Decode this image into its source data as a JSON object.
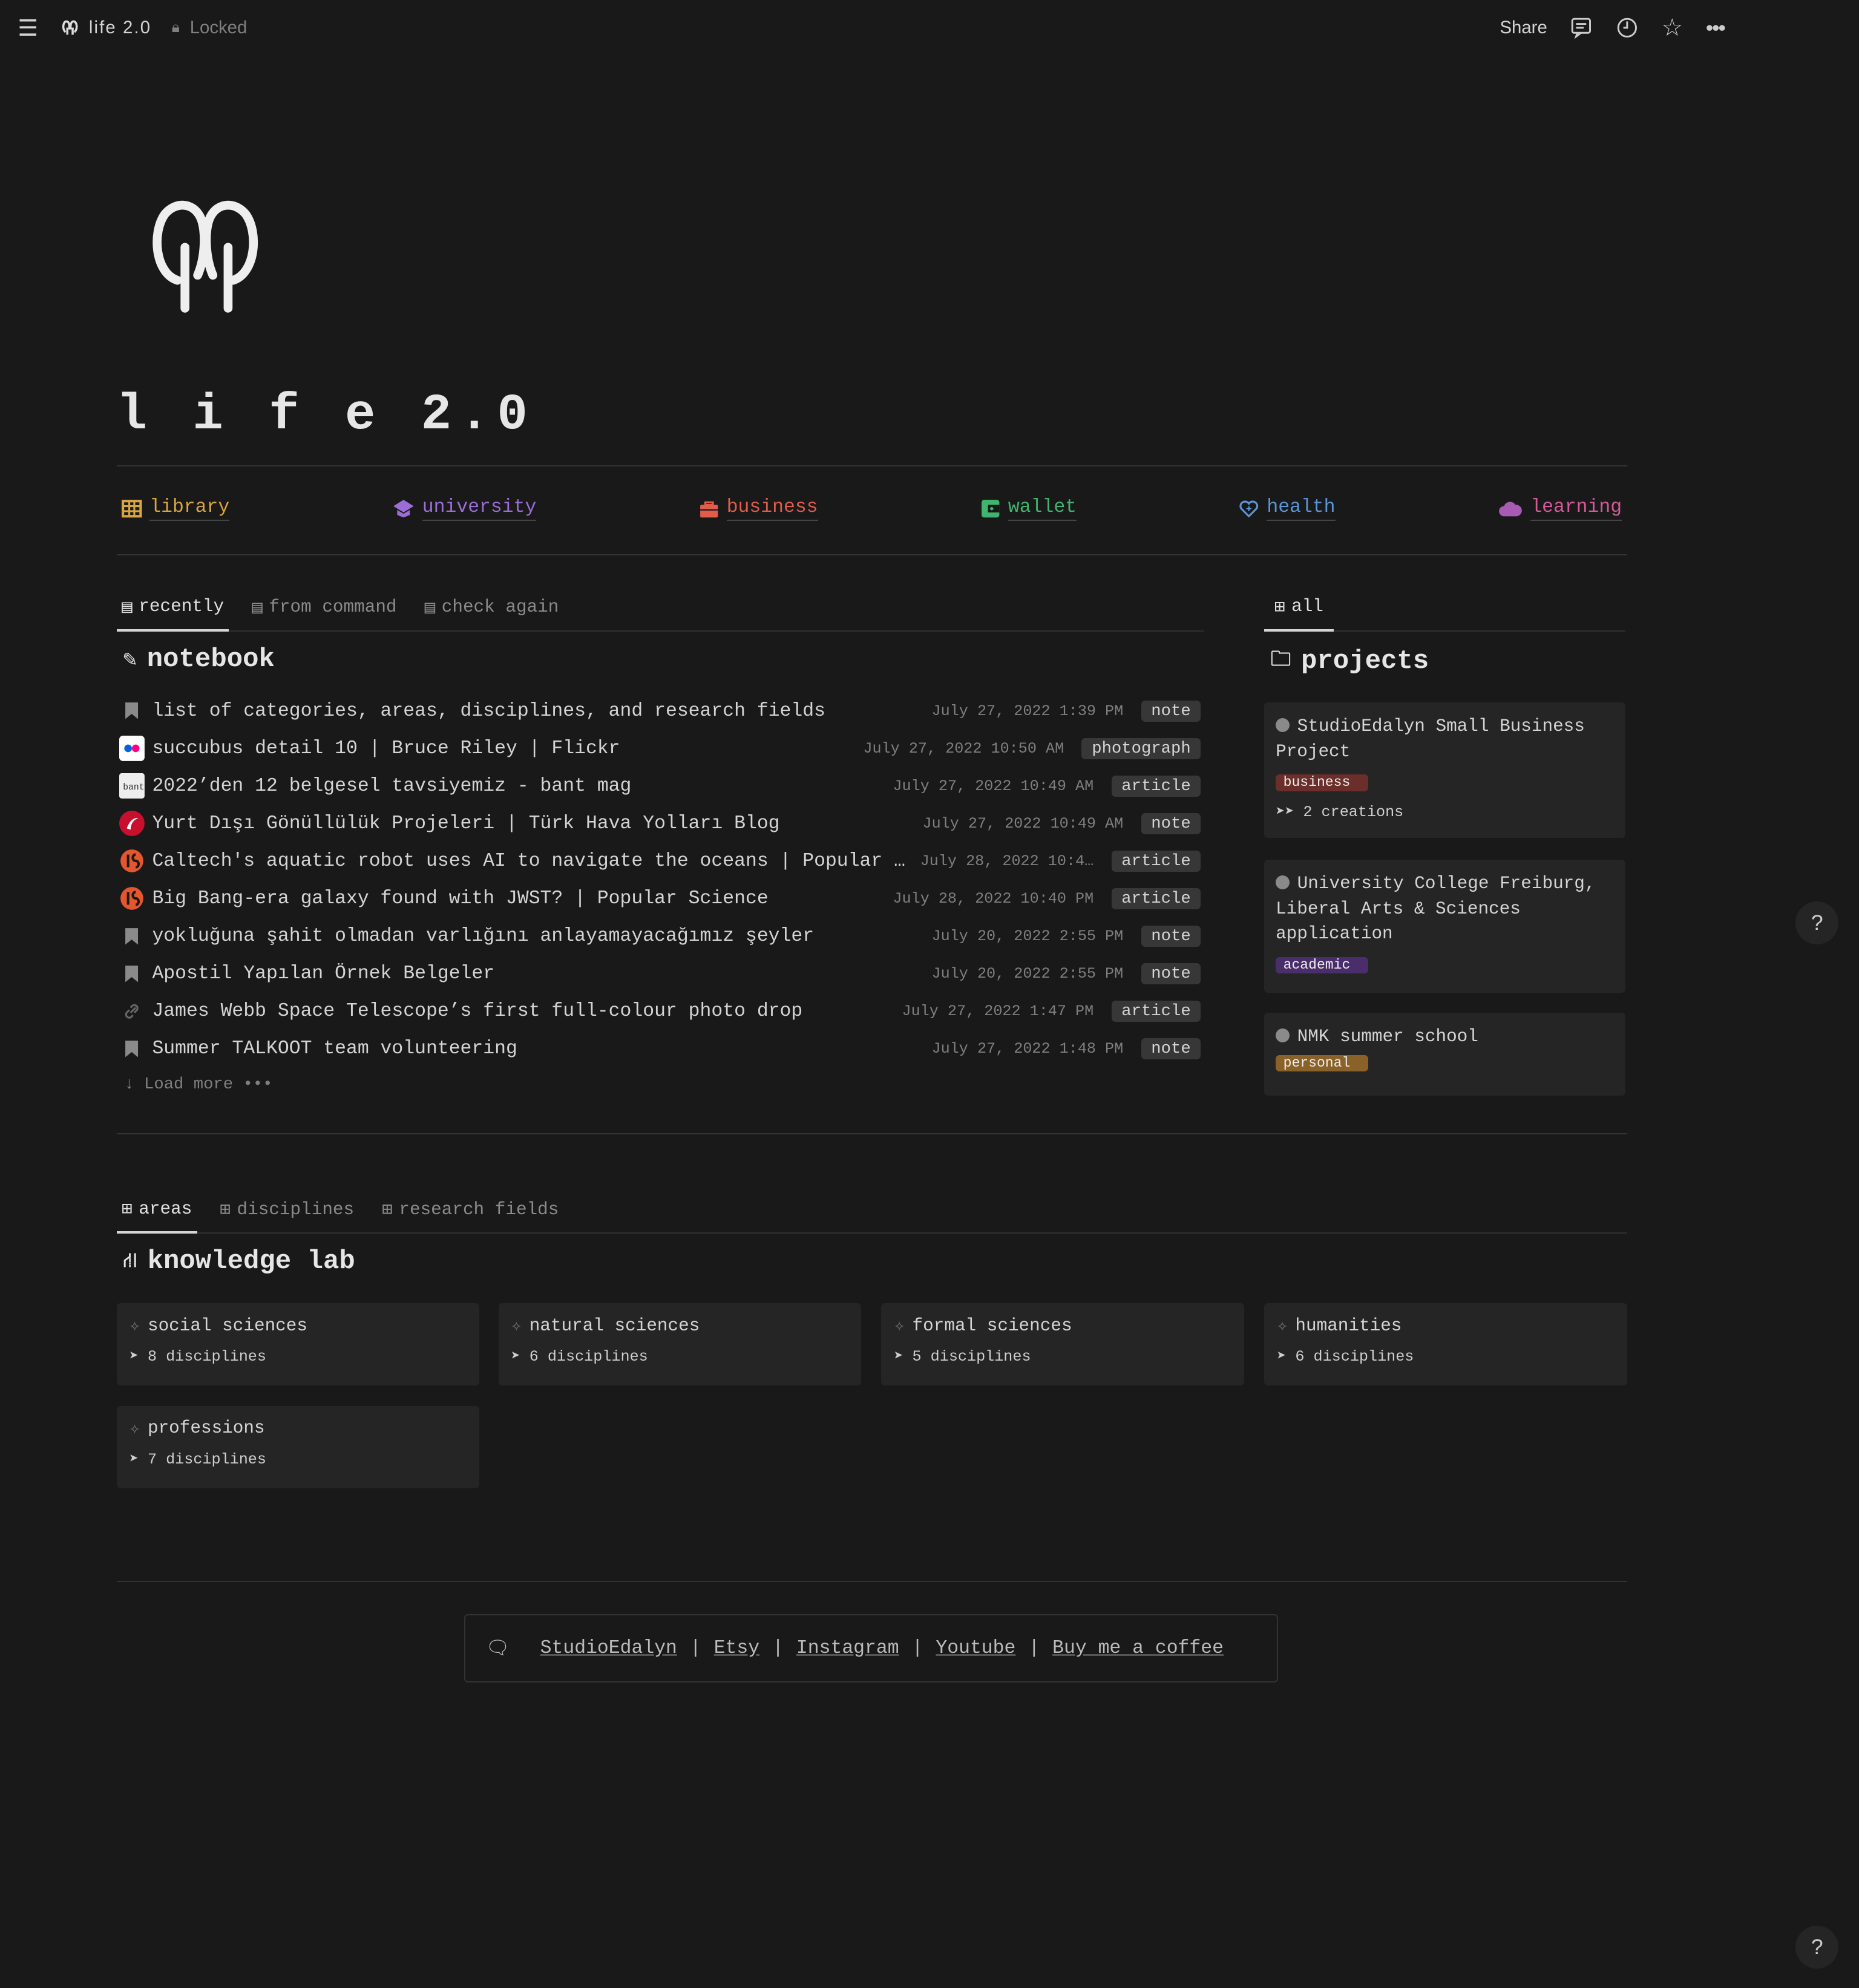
{
  "topbar": {
    "page_title": "life 2.0",
    "lock_label": "Locked",
    "share_label": "Share"
  },
  "page": {
    "title": "l i f e 2.0"
  },
  "links": [
    {
      "label": "library",
      "color": "#d9a53f"
    },
    {
      "label": "university",
      "color": "#9a6dd7"
    },
    {
      "label": "business",
      "color": "#e05c4b"
    },
    {
      "label": "wallet",
      "color": "#3fb56f"
    },
    {
      "label": "health",
      "color": "#5b95d6"
    },
    {
      "label": "learning",
      "color": "#d55a9a"
    }
  ],
  "notebook": {
    "tabs": [
      "recently",
      "from command",
      "check again"
    ],
    "title": "notebook",
    "items": [
      {
        "name": "list of categories, areas, disciplines, and research fields",
        "date": "July 27, 2022 1:39 PM",
        "tag": "note",
        "icon": "bookmark"
      },
      {
        "name": "succubus detail 10 | Bruce Riley | Flickr",
        "date": "July 27, 2022 10:50 AM",
        "tag": "photograph",
        "icon": "flickr"
      },
      {
        "name": "2022’den 12 belgesel tavsiyemiz - bant mag",
        "date": "July 27, 2022 10:49 AM",
        "tag": "article",
        "icon": "bant"
      },
      {
        "name": "Yurt Dışı Gönüllülük Projeleri | Türk Hava Yolları Blog",
        "date": "July 27, 2022 10:49 AM",
        "tag": "note",
        "icon": "thy"
      },
      {
        "name": "Caltech's aquatic robot uses AI to navigate the oceans | Popular Science",
        "date": "July 28, 2022 10:4…",
        "tag": "article",
        "icon": "popsci"
      },
      {
        "name": "Big Bang-era galaxy found with JWST? | Popular Science",
        "date": "July 28, 2022 10:40 PM",
        "tag": "article",
        "icon": "popsci"
      },
      {
        "name": "yokluğuna şahit olmadan varlığını anlayamayacağımız şeyler",
        "date": "July 20, 2022 2:55 PM",
        "tag": "note",
        "icon": "bookmark"
      },
      {
        "name": "Apostil Yapılan Örnek Belgeler",
        "date": "July 20, 2022 2:55 PM",
        "tag": "note",
        "icon": "bookmark"
      },
      {
        "name": "James Webb Space Telescope’s first full-colour photo drop",
        "date": "July 27, 2022 1:47 PM",
        "tag": "article",
        "icon": "link"
      },
      {
        "name": "Summer TALKOOT team volunteering",
        "date": "July 27, 2022 1:48 PM",
        "tag": "note",
        "icon": "bookmark"
      }
    ],
    "load_more": "Load more"
  },
  "projects": {
    "tab": "all",
    "title": "projects",
    "items": [
      {
        "name": "StudioEdalyn Small Business Project",
        "tag": "business",
        "tag_color": "#6b2e2b",
        "sub": "2 creations"
      },
      {
        "name": "University College Freiburg, Liberal Arts & Sciences application",
        "tag": "academic",
        "tag_color": "#4a2d6b"
      },
      {
        "name": "NMK summer school",
        "tag": "personal",
        "tag_color": "#8a6128"
      }
    ]
  },
  "knowledge": {
    "tabs": [
      "areas",
      "disciplines",
      "research fields"
    ],
    "title": "knowledge lab",
    "areas": [
      {
        "name": "social sciences",
        "count": "8 disciplines"
      },
      {
        "name": "natural sciences",
        "count": "6 disciplines"
      },
      {
        "name": "formal sciences",
        "count": "5 disciplines"
      },
      {
        "name": "humanities",
        "count": "6 disciplines"
      },
      {
        "name": "professions",
        "count": "7 disciplines"
      }
    ]
  },
  "footer": {
    "links": [
      "StudioEdalyn",
      "Etsy",
      "Instagram",
      "Youtube",
      "Buy me a coffee"
    ]
  },
  "help": "?"
}
